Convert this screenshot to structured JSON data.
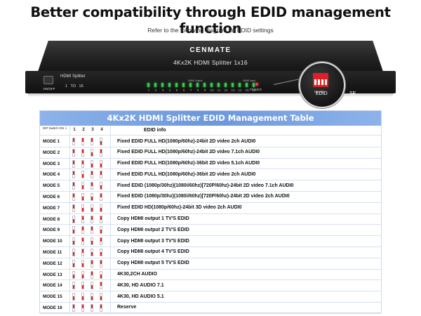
{
  "headline": "Better compatibility through EDID management function",
  "subline": "Refer to the following diagram for EDID settings",
  "device": {
    "brand": "CENMATE",
    "model": "4Kx2K HDMI Splitter 1x16",
    "power_switch_label": "ON/OFF",
    "hdmi_label": "HDMI Splitter",
    "range_label": "1 TO 16",
    "output_caption": "HDMI Output",
    "input_caption": "HDMI Input",
    "power_label": "POWER",
    "led_numbers": [
      "1",
      "2",
      "3",
      "4",
      "5",
      "6",
      "7",
      "8",
      "9",
      "10",
      "11",
      "12",
      "13",
      "14",
      "15",
      "16"
    ],
    "dip_caption": "ON DIP",
    "edid_label": "EDID",
    "select_label": "SE"
  },
  "table": {
    "title": "4Kx2K HDMI Splitter EDID Management Table",
    "header_dip": "DIP Switch ON ⇩",
    "header_nums": [
      "1",
      "2",
      "3",
      "4"
    ],
    "header_info": "EDID info",
    "rows": [
      {
        "mode": "MODE 1",
        "switches": [
          1,
          1,
          1,
          0
        ],
        "desc": "Fixed EDID FULL HD(1080p/60hz)-24bit 2D video 2ch AUDI0"
      },
      {
        "mode": "MODE 2",
        "switches": [
          1,
          1,
          0,
          1
        ],
        "desc": "Fixed EDID FULL HD(1080p/60hz)-24bit 2D video 7.1ch AUDI0"
      },
      {
        "mode": "MODE 3",
        "switches": [
          1,
          1,
          0,
          0
        ],
        "desc": "Fixed EDID FULL HD(1080p/60hz)-36bit 2D video 5.1ch AUDI0"
      },
      {
        "mode": "MODE 4",
        "switches": [
          1,
          0,
          1,
          1
        ],
        "desc": "Fixed EDID FULL HD(1080p/60hz)-36bit 2D video 2ch AUDI0"
      },
      {
        "mode": "MODE 5",
        "switches": [
          1,
          0,
          1,
          0
        ],
        "desc": "Fixed EDID (1080p/30hz)(1080i/60hz)[720P/60hz)-24bit 2D video 7.1ch AUDI0"
      },
      {
        "mode": "MODE 6",
        "switches": [
          1,
          0,
          0,
          1
        ],
        "desc": "Fixed EDID (1080p/30hz)(1080i/60hz)[720P/60hz)-24bit 2D video 2ch AUDI0"
      },
      {
        "mode": "MODE 7",
        "switches": [
          1,
          0,
          0,
          0
        ],
        "desc": "Fixed EDID HD(1080p/60hz)-24bit 3D video 2ch AUDI0"
      },
      {
        "mode": "MODE 8",
        "switches": [
          0,
          1,
          1,
          1
        ],
        "desc": "Copy HDMI output 1 TV'S EDID"
      },
      {
        "mode": "MODE 9",
        "switches": [
          0,
          1,
          1,
          0
        ],
        "desc": "Copy HDMI output 2 TV'S EDID"
      },
      {
        "mode": "MODE 10",
        "switches": [
          0,
          1,
          0,
          1
        ],
        "desc": "Copy HDMI output 3 TV'S EDID"
      },
      {
        "mode": "MODE 11",
        "switches": [
          0,
          1,
          0,
          0
        ],
        "desc": "Copy HDMI output 4 TV'S EDID"
      },
      {
        "mode": "MODE 12",
        "switches": [
          0,
          0,
          1,
          1
        ],
        "desc": "Copy HDMI output 5 TV'S EDID"
      },
      {
        "mode": "MODE 13",
        "switches": [
          0,
          0,
          1,
          0
        ],
        "desc": "4K30,2CH AUDIO"
      },
      {
        "mode": "MODE 14",
        "switches": [
          0,
          0,
          0,
          1
        ],
        "desc": "4K30, HD AUDIO 7.1"
      },
      {
        "mode": "MODE 15",
        "switches": [
          0,
          0,
          0,
          0
        ],
        "desc": "4K30, HD AUDIO 5.1"
      },
      {
        "mode": "MODE 16",
        "switches": [
          1,
          1,
          1,
          1
        ],
        "desc": "Reserve"
      }
    ]
  },
  "colors": {
    "switch_red": "#e01e26",
    "title_blue": "#6b97db",
    "led_green": "#35d04a"
  }
}
